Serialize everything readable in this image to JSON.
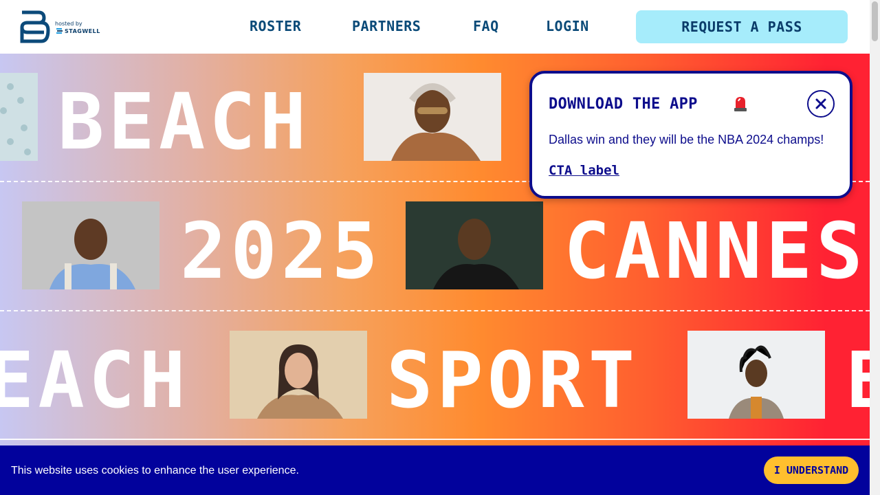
{
  "header": {
    "logo_hosted_by": "hosted by",
    "logo_partner": "STAGWELL",
    "nav": [
      {
        "label": "ROSTER"
      },
      {
        "label": "PARTNERS"
      },
      {
        "label": "FAQ"
      },
      {
        "label": "LOGIN"
      }
    ],
    "request_pass_label": "REQUEST A PASS"
  },
  "hero": {
    "rows": [
      {
        "words": [
          "BEACH"
        ]
      },
      {
        "words": [
          "2025",
          "CANNES"
        ]
      },
      {
        "words": [
          "EACH",
          "SPORT",
          "B"
        ]
      }
    ],
    "photos": [
      {
        "icon": "person-photo"
      },
      {
        "icon": "person-photo"
      },
      {
        "icon": "person-photo"
      },
      {
        "icon": "person-photo"
      },
      {
        "icon": "person-photo"
      }
    ],
    "colors": {
      "start": "#c7c7f2",
      "mid": "#ff8b2f",
      "end": "#ff2233"
    }
  },
  "popup": {
    "title": "DOWNLOAD THE APP",
    "title_icon": "siren-icon",
    "body": "Dallas win and they will be the NBA 2024 champs!",
    "cta_label": "CTA label",
    "close_icon": "close-icon",
    "accent": "#0d0d8c"
  },
  "cookie_bar": {
    "text": "This website uses cookies to enhance the user experience.",
    "button_label": "I UNDERSTAND",
    "background": "#02029c",
    "button_color": "#ffbf2e"
  }
}
